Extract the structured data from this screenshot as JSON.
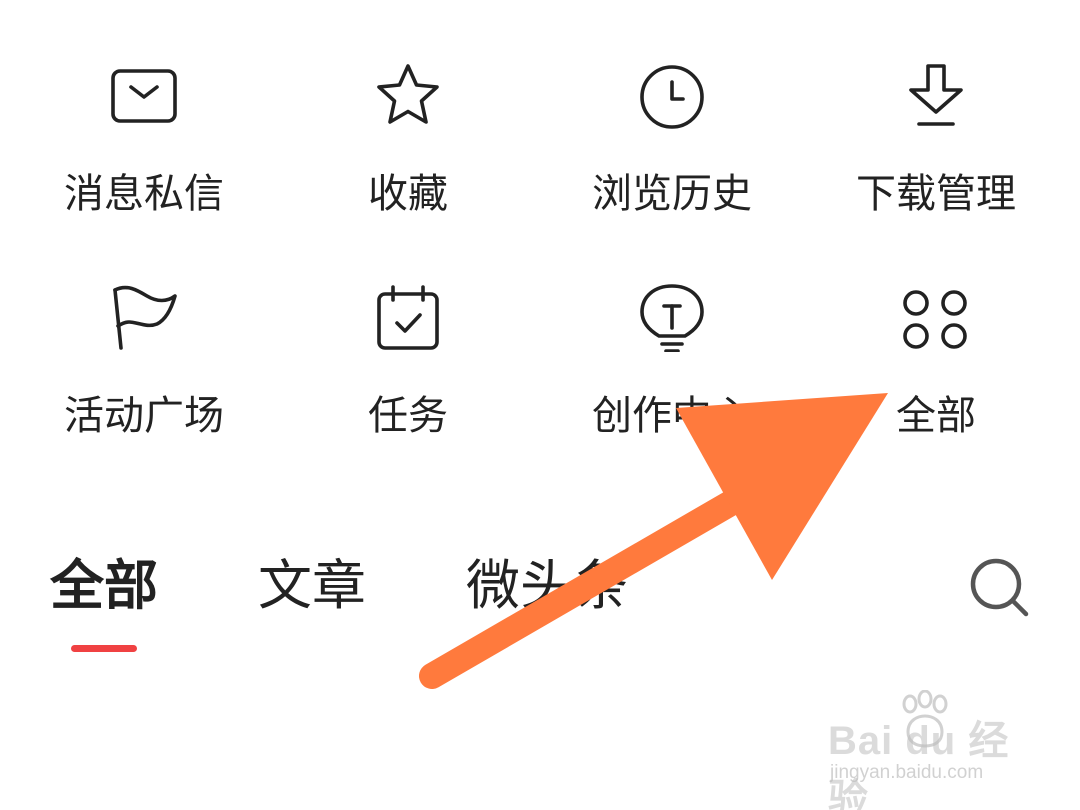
{
  "menu_grid": [
    {
      "label": "消息私信",
      "icon": "mail-icon"
    },
    {
      "label": "收藏",
      "icon": "star-icon"
    },
    {
      "label": "浏览历史",
      "icon": "clock-icon"
    },
    {
      "label": "下载管理",
      "icon": "download-icon"
    },
    {
      "label": "活动广场",
      "icon": "flag-icon"
    },
    {
      "label": "任务",
      "icon": "calendar-check-icon"
    },
    {
      "label": "创作中心",
      "icon": "lightbulb-icon"
    },
    {
      "label": "全部",
      "icon": "grid-circles-icon"
    }
  ],
  "tabs": [
    {
      "label": "全部",
      "active": true
    },
    {
      "label": "文章",
      "active": false
    },
    {
      "label": "微头条",
      "active": false
    }
  ],
  "search_icon": "search-icon",
  "accent_color": "#f04142",
  "annotation_arrow_color": "#ff7a3d",
  "watermark": {
    "brand": "Bai du 经验",
    "url": "jingyan.baidu.com"
  }
}
